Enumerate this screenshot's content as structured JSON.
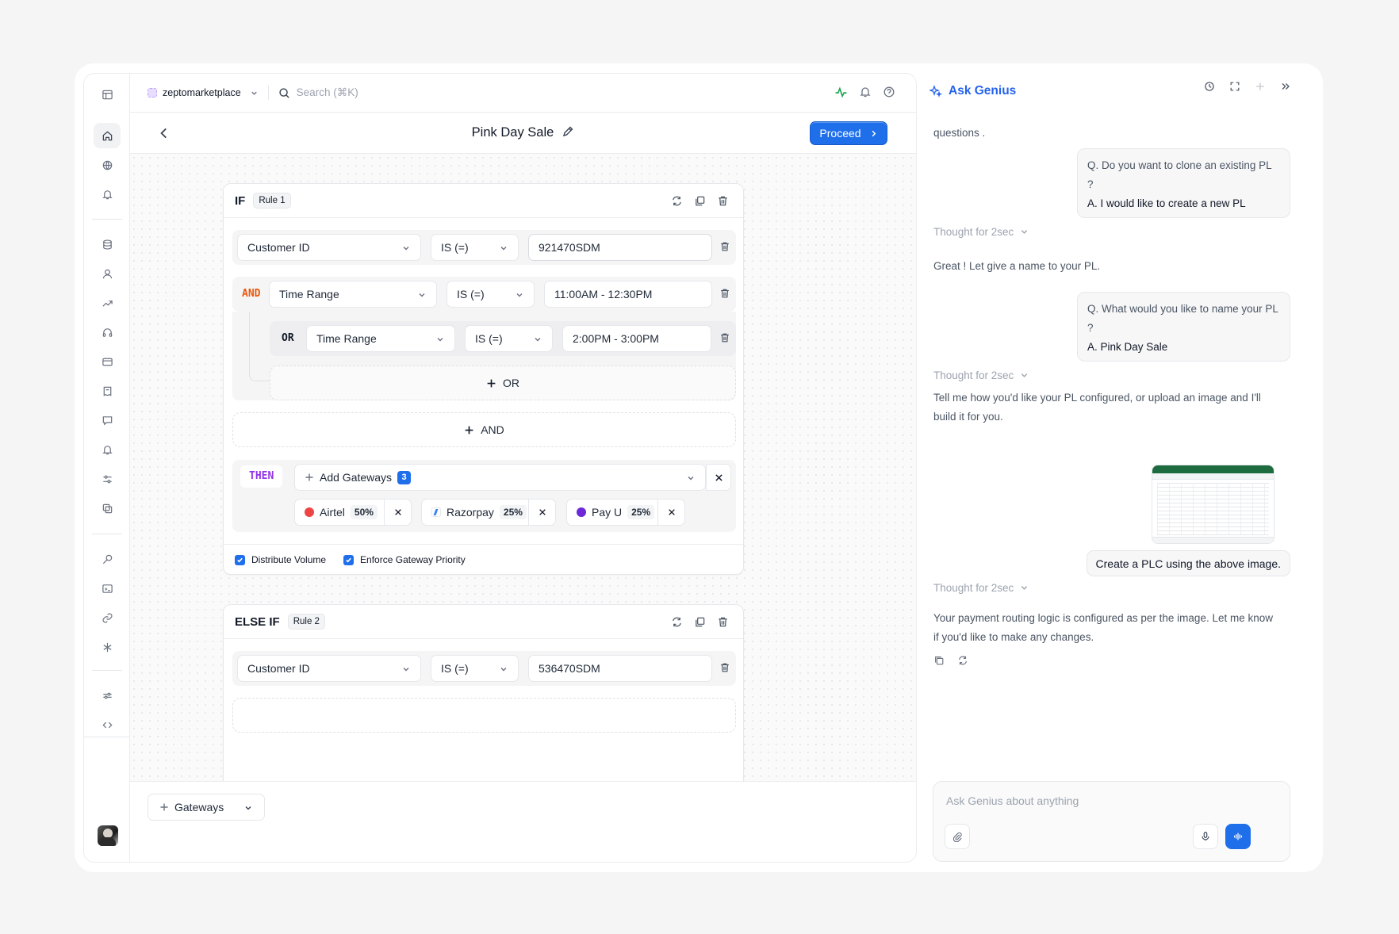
{
  "workspace": {
    "name": "zeptomarketplace"
  },
  "search": {
    "placeholder": "Search (⌘K)"
  },
  "page": {
    "title": "Pink Day Sale",
    "proceed_label": "Proceed"
  },
  "rule1": {
    "keyword": "IF",
    "badge": "Rule 1",
    "conditions": [
      {
        "field": "Customer ID",
        "operator": "IS (=)",
        "value": "921470SDM"
      },
      {
        "connector": "AND",
        "field": "Time Range",
        "operator": "IS (=)",
        "value": "11:00AM - 12:30PM"
      },
      {
        "connector": "OR",
        "field": "Time Range",
        "operator": "IS (=)",
        "value": "2:00PM - 3:00PM"
      }
    ],
    "add_or_label": "OR",
    "add_and_label": "AND",
    "then_label": "THEN",
    "add_gateways_label": "Add Gateways",
    "gateway_count": "3",
    "gateways": [
      {
        "name": "Airtel",
        "percent": "50%",
        "color": "#ef4444"
      },
      {
        "name": "Razorpay",
        "percent": "25%",
        "color": "#3b82f6"
      },
      {
        "name": "Pay U",
        "percent": "25%",
        "color": "#6d28d9"
      }
    ],
    "distribute_volume_label": "Distribute Volume",
    "enforce_priority_label": "Enforce Gateway Priority"
  },
  "rule2": {
    "keyword": "ELSE IF",
    "badge": "Rule 2",
    "conditions": [
      {
        "field": "Customer ID",
        "operator": "IS (=)",
        "value": "536470SDM"
      }
    ]
  },
  "bottom": {
    "gateways_label": "Gateways"
  },
  "genius": {
    "title": "Ask Genius",
    "intro_text": "questions .",
    "qa1": {
      "q": "Q. Do you want to clone an existing PL ?",
      "a": "A. I would like to create a new PL"
    },
    "thought1": "Thought for 2sec",
    "msg1": "Great ! Let give a name to your PL.",
    "qa2": {
      "q": "Q. What would you like to name your PL ?",
      "a": "A. Pink Day Sale"
    },
    "thought2": "Thought for 2sec",
    "msg2_line1": "Tell me how you'd like your PL configured, or upload an image and I'll",
    "msg2_line2": "build it for you.",
    "user_msg": "Create a PLC using the above image.",
    "thought3": "Thought for 2sec",
    "msg3_line1": "Your payment routing logic is configured as per the image. Let me know",
    "msg3_line2": "if you'd like to make any changes.",
    "input_placeholder": "Ask Genius about anything"
  },
  "colors": {
    "accent": "#1f6feb",
    "and": "#ea580c",
    "then": "#9333ea",
    "genius": "#2563eb"
  }
}
